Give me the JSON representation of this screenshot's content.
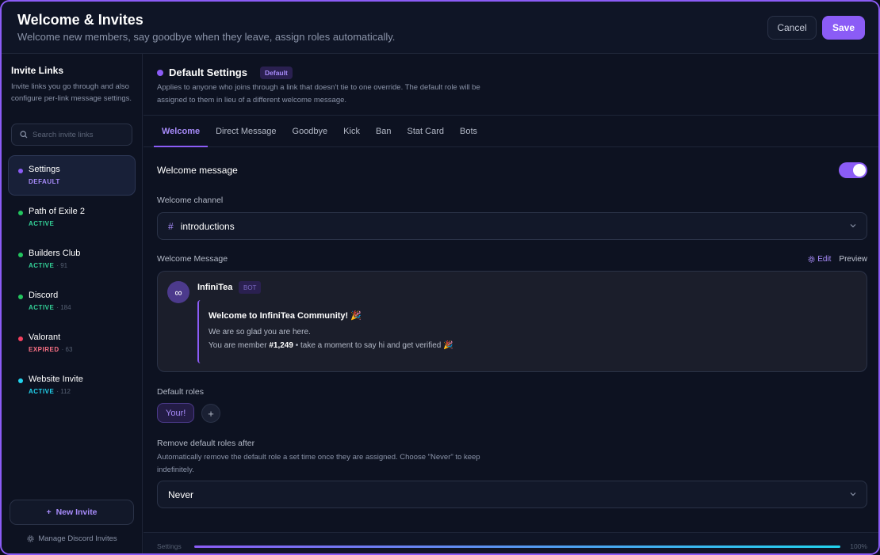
{
  "header": {
    "title": "Welcome & Invites",
    "subtitle": "Welcome new members, say goodbye when they leave, assign roles automatically.",
    "cancel_label": "Cancel",
    "save_label": "Save"
  },
  "sidebar": {
    "title": "Invite Links",
    "description": "Invite links you go through and also configure per-link message settings.",
    "search_placeholder": "Search invite links",
    "items": [
      {
        "name": "Settings",
        "status": "DEFAULT",
        "count": "",
        "color": "#8b5cf6",
        "status_color": "#a78bfa"
      },
      {
        "name": "Path of Exile 2",
        "status": "ACTIVE",
        "count": "",
        "color": "#22c55e",
        "status_color": "#34d399"
      },
      {
        "name": "Builders Club",
        "status": "ACTIVE",
        "count": "· 91",
        "color": "#22c55e",
        "status_color": "#34d399"
      },
      {
        "name": "Discord",
        "status": "ACTIVE",
        "count": "· 184",
        "color": "#22c55e",
        "status_color": "#34d399"
      },
      {
        "name": "Valorant",
        "status": "EXPIRED",
        "count": "· 63",
        "color": "#f43f5e",
        "status_color": "#fb7185"
      },
      {
        "name": "Website Invite",
        "status": "ACTIVE",
        "count": "· 112",
        "color": "#22d3ee",
        "status_color": "#22d3ee"
      }
    ],
    "new_invite_label": "New Invite",
    "manage_label": "Manage Discord Invites"
  },
  "main": {
    "title": "Default Settings",
    "badge": "Default",
    "description": "Applies to anyone who joins through a link that doesn't tie to one override. The default role will be assigned to them in lieu of a different welcome message.",
    "tabs": [
      "Welcome",
      "Direct Message",
      "Goodbye",
      "Kick",
      "Ban",
      "Stat Card",
      "Bots"
    ],
    "active_tab": "Welcome",
    "welcome_message_label": "Welcome message",
    "welcome_enabled": true,
    "welcome_channel_label": "Welcome channel",
    "welcome_channel_value": "introductions",
    "message_label": "Welcome Message",
    "edit_label": "Edit",
    "preview_label": "Preview",
    "message": {
      "avatar_glyph": "∞",
      "bot_name": "InfiniTea",
      "bot_badge": "BOT",
      "embed_title": "Welcome to InfiniTea Community! 🎉",
      "line1": "We are so glad you are here.",
      "line2_prefix": "You are member ",
      "line2_number": "#1,249",
      "line2_suffix": " • take a moment to say hi and get verified 🎉"
    },
    "default_roles_label": "Default roles",
    "roles": [
      "Your!"
    ],
    "add_role_glyph": "+",
    "remove_roles_label": "Remove default roles after",
    "remove_roles_desc": "Automatically remove the default role a set time once they are assigned. Choose \"Never\" to keep indefinitely.",
    "remove_roles_value": "Never"
  },
  "footer": {
    "left_label": "Settings",
    "progress": 1.0,
    "right_label": "100%"
  }
}
